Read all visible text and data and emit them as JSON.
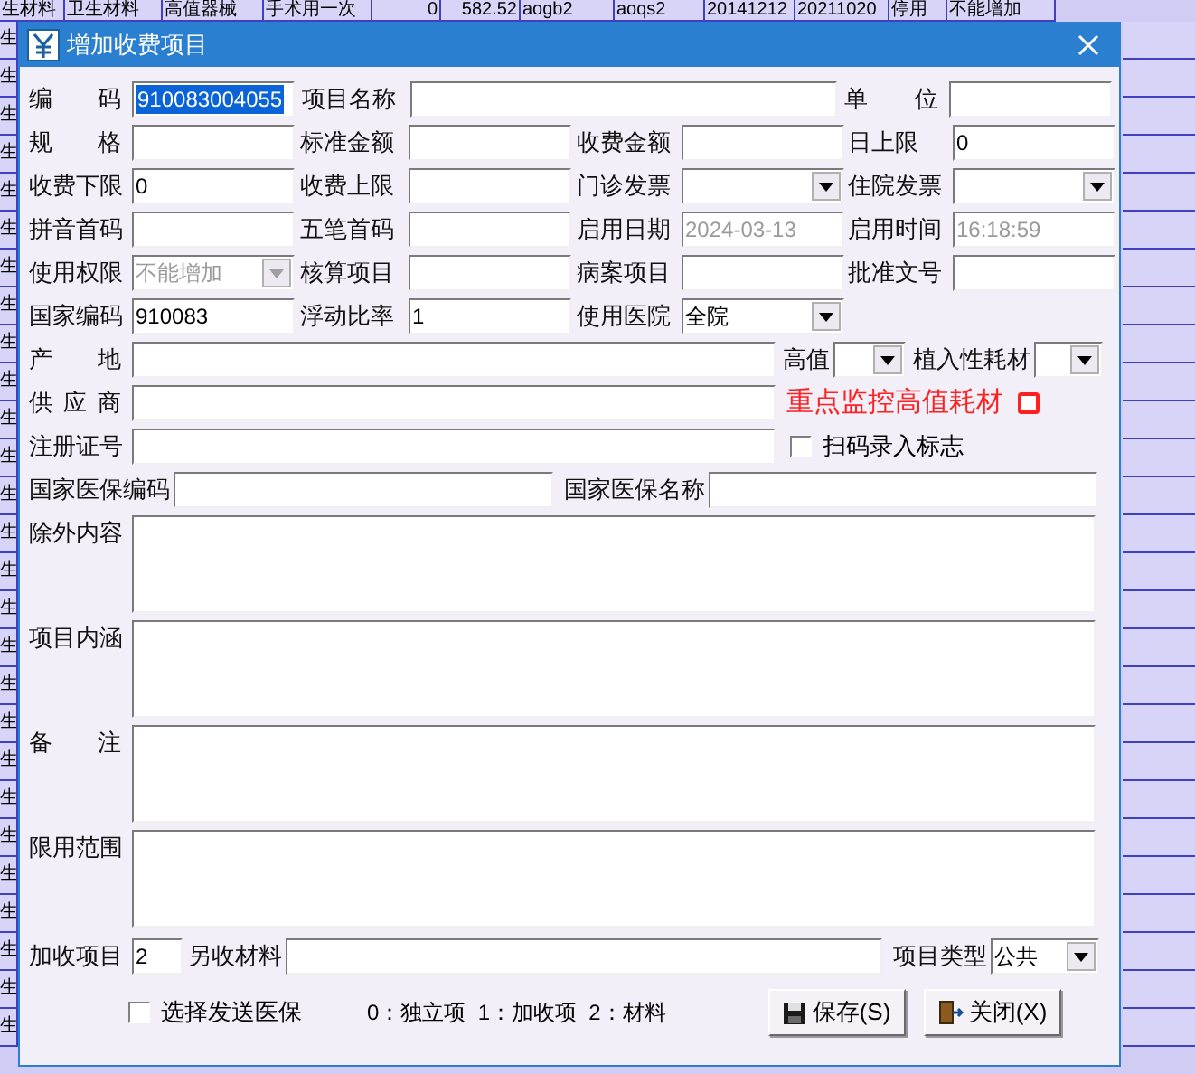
{
  "background_table": {
    "top_row": [
      "生材料",
      "卫生材料",
      "高值器械",
      "手术用一次",
      "0",
      "582.52",
      "aogb2",
      "aoqs2",
      "20141212",
      "20211020",
      "停用",
      "不能增加"
    ],
    "left_column": [
      "生",
      "生",
      "生",
      "生",
      "生",
      "生",
      "生",
      "生",
      "生",
      "生",
      "生",
      "生",
      "生",
      "生",
      "生",
      "生",
      "生",
      "生",
      "生",
      "生",
      "生",
      "生",
      "生",
      "生",
      "生",
      "生",
      "生"
    ]
  },
  "window": {
    "title": "增加收费项目"
  },
  "rows": [
    {
      "items": [
        {
          "kind": "text_field",
          "label": "编 码",
          "value": "910083004055",
          "highlighted": true
        },
        {
          "kind": "text_field",
          "label": "项目名称"
        },
        {
          "kind": "text_field",
          "label": "单 位"
        }
      ]
    },
    {
      "items": [
        {
          "kind": "text_field",
          "label": "规 格"
        },
        {
          "kind": "text_field",
          "label": "标准金额"
        },
        {
          "kind": "text_field",
          "label": "收费金额"
        },
        {
          "kind": "text_field",
          "label": "日上限",
          "value": "0"
        }
      ]
    },
    {
      "items": [
        {
          "kind": "text_field",
          "label": "收费下限",
          "value": "0"
        },
        {
          "kind": "text_field",
          "label": "收费上限"
        },
        {
          "kind": "dropdown",
          "label": "门诊发票"
        },
        {
          "kind": "dropdown",
          "label": "住院发票"
        }
      ]
    },
    {
      "items": [
        {
          "kind": "text_field",
          "label": "拼音首码"
        },
        {
          "kind": "text_field",
          "label": "五笔首码"
        },
        {
          "kind": "text_field",
          "label": "启用日期",
          "value": "2024-03-13",
          "disabled": true
        },
        {
          "kind": "text_field",
          "label": "启用时间",
          "value": "16:18:59",
          "disabled": true
        }
      ]
    },
    {
      "items": [
        {
          "kind": "dropdown",
          "label": "使用权限",
          "value": "不能增加",
          "disabled": true
        },
        {
          "kind": "text_field",
          "label": "核算项目"
        },
        {
          "kind": "text_field",
          "label": "病案项目"
        },
        {
          "kind": "text_field",
          "label": "批准文号"
        }
      ]
    },
    {
      "items": [
        {
          "kind": "text_field",
          "label": "国家编码",
          "value": "910083"
        },
        {
          "kind": "text_field",
          "label": "浮动比率",
          "value": "1"
        },
        {
          "kind": "dropdown",
          "label": "使用医院",
          "value": "全院"
        }
      ]
    },
    {
      "items": [
        {
          "kind": "text_field",
          "label": "产 地"
        },
        {
          "kind": "dropdown",
          "label": "高值"
        },
        {
          "kind": "dropdown",
          "label": "植入性耗材"
        }
      ]
    },
    {
      "items": [
        {
          "kind": "text_field",
          "label": "供 应 商"
        },
        {
          "kind": "alert",
          "label": "重点监控高值耗材",
          "checked": false
        }
      ]
    },
    {
      "items": [
        {
          "kind": "text_field",
          "label": "注册证号"
        },
        {
          "kind": "checkbox",
          "label": "扫码录入标志",
          "checked": false
        }
      ]
    },
    {
      "items": [
        {
          "kind": "text_field",
          "label": "国家医保编码"
        },
        {
          "kind": "text_field",
          "label": "国家医保名称"
        }
      ]
    }
  ],
  "text_areas": [
    {
      "label": "除外内容"
    },
    {
      "label": "项目内涵"
    },
    {
      "label": "备 注"
    },
    {
      "label": "限用范围"
    }
  ],
  "last_row": {
    "items": [
      {
        "kind": "text_field",
        "label": "加收项目",
        "value": "2"
      },
      {
        "kind": "text_field",
        "label": "另收材料"
      },
      {
        "kind": "dropdown",
        "label": "项目类型",
        "value": "公共"
      }
    ]
  },
  "footer": {
    "checkbox": {
      "label": "选择发送医保",
      "checked": false
    },
    "legend": "0：独立项  1：加收项  2：材料",
    "buttons": [
      {
        "kind": "save",
        "label": "保存(S)"
      },
      {
        "kind": "close",
        "label": "关闭(X)"
      }
    ]
  }
}
